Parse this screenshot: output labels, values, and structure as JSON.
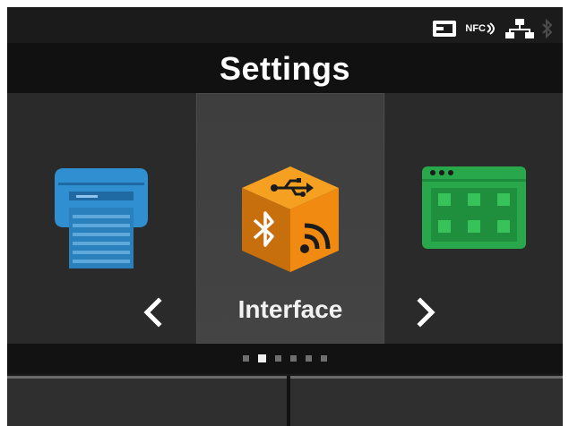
{
  "status": {
    "icons": [
      "sd-card-icon",
      "nfc-icon",
      "lan-icon",
      "bluetooth-icon"
    ],
    "nfc_label": "NFC"
  },
  "header": {
    "title": "Settings"
  },
  "carousel": {
    "prev_item": "printing-icon",
    "current_item": {
      "label": "Interface",
      "icon": "interface-cube-icon"
    },
    "next_item": "applications-icon",
    "prev_arrow": "chevron-left-icon",
    "next_arrow": "chevron-right-icon",
    "page_count": 6,
    "active_page_index": 1
  },
  "colors": {
    "background": "#1b1b1b",
    "title": "#ffffff",
    "printer_blue": "#2f8fd0",
    "interface_orange": "#f08a10",
    "app_green": "#28a84a"
  }
}
